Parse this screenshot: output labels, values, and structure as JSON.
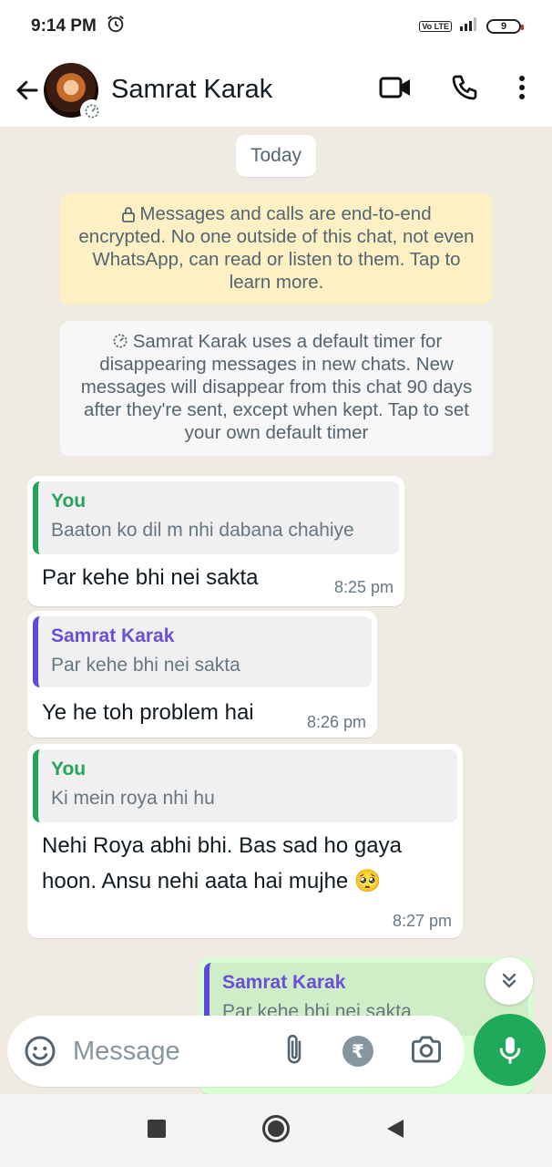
{
  "status_bar": {
    "time": "9:14 PM",
    "network_badge": "Vo LTE",
    "battery": "9"
  },
  "header": {
    "contact_name": "Samrat Karak",
    "icons": [
      "back-arrow-icon",
      "video-call-icon",
      "voice-call-icon",
      "more-options-icon"
    ]
  },
  "chat": {
    "date_chip": "Today",
    "encryption_notice": "Messages and calls are end-to-end encrypted. No one outside of this chat, not even WhatsApp, can read or listen to them. Tap to learn more.",
    "timer_notice": "Samrat Karak uses a default timer for disappearing messages in new chats. New messages will disappear from this chat 90 days after they're sent, except when kept. Tap to set your own default timer",
    "messages": [
      {
        "direction": "incoming",
        "quote_author": "You",
        "quote_text": "Baaton ko dil m nhi dabana chahiye",
        "text": "Par kehe bhi nei sakta",
        "time": "8:25 pm"
      },
      {
        "direction": "incoming",
        "quote_author": "Samrat Karak",
        "quote_text": "Par kehe bhi nei sakta",
        "text": "Ye he toh problem hai",
        "time": "8:26 pm"
      },
      {
        "direction": "incoming",
        "quote_author": "You",
        "quote_text": "Ki mein roya nhi hu",
        "text_line1": "Nehi Roya abhi bhi. Bas sad ho gaya",
        "text_line2": "hoon. Ansu nehi aata hai mujhe 🥺",
        "time": "8:27 pm"
      },
      {
        "direction": "outgoing",
        "quote_author": "Samrat Karak",
        "quote_text_partial": "Par kehe bhi nei sakta"
      }
    ]
  },
  "composer": {
    "placeholder": "Message",
    "rupee_symbol": "₹",
    "icons": [
      "emoji-icon",
      "attach-icon",
      "payment-icon",
      "camera-icon",
      "mic-icon"
    ]
  },
  "colors": {
    "accent_green": "#1faa59",
    "quote_you": "#25a35a",
    "quote_contact": "#6b4fd6",
    "chat_background": "#efeae2",
    "encryption_bg": "#fdf0c4",
    "outgoing_bubble": "#d9fdd3"
  }
}
